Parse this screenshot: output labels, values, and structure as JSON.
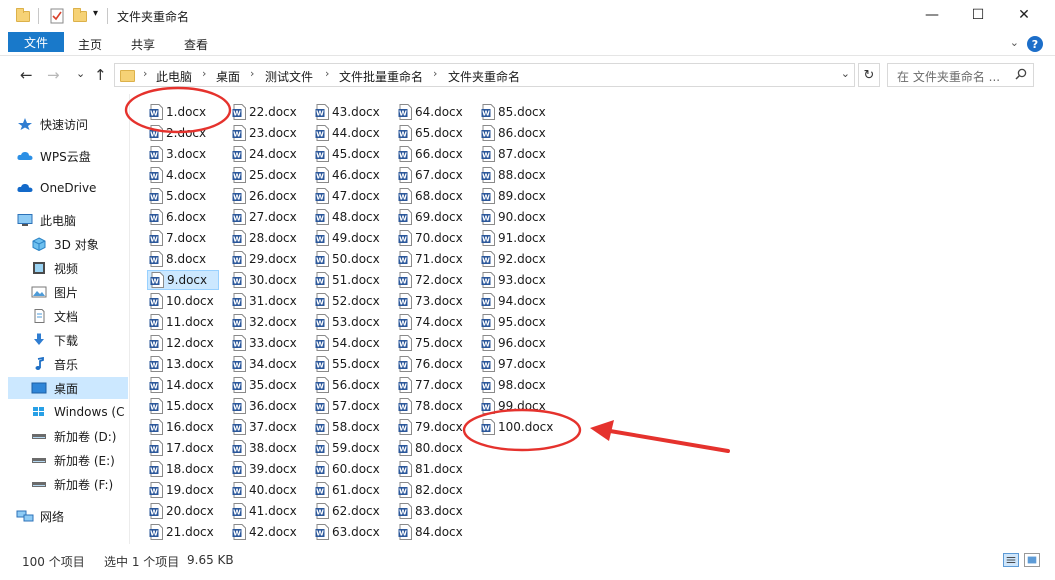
{
  "window": {
    "title": "文件夹重命名",
    "min_glyph": "—",
    "max_glyph": "☐",
    "close_glyph": "✕"
  },
  "ribbon": {
    "tabs": [
      "文件",
      "主页",
      "共享",
      "查看"
    ],
    "help_glyph": "?",
    "expand_glyph": "⌄"
  },
  "nav": {
    "back_glyph": "←",
    "forward_glyph": "→",
    "recent_glyph": "⌄",
    "up_glyph": "↑",
    "breadcrumb": [
      "此电脑",
      "桌面",
      "测试文件",
      "文件批量重命名",
      "文件夹重命名"
    ],
    "crumb_sep": "›",
    "refresh_glyph": "↻",
    "search_placeholder": "在 文件夹重命名 ..."
  },
  "sidebar": {
    "items": [
      {
        "label": "快速访问",
        "icon": "star-icon"
      },
      {
        "label": "WPS云盘",
        "icon": "cloud-icon"
      },
      {
        "label": "OneDrive",
        "icon": "onedrive-icon"
      },
      {
        "label": "此电脑",
        "icon": "computer-icon"
      },
      {
        "label": "3D 对象",
        "icon": "cube-icon"
      },
      {
        "label": "视频",
        "icon": "video-icon"
      },
      {
        "label": "图片",
        "icon": "picture-icon"
      },
      {
        "label": "文档",
        "icon": "document-icon"
      },
      {
        "label": "下载",
        "icon": "download-icon"
      },
      {
        "label": "音乐",
        "icon": "music-icon"
      },
      {
        "label": "桌面",
        "icon": "desktop-icon"
      },
      {
        "label": "Windows (C",
        "icon": "windows-drive-icon"
      },
      {
        "label": "新加卷 (D:)",
        "icon": "drive-icon"
      },
      {
        "label": "新加卷 (E:)",
        "icon": "drive-icon"
      },
      {
        "label": "新加卷 (F:)",
        "icon": "drive-icon"
      },
      {
        "label": "网络",
        "icon": "network-icon"
      }
    ],
    "selected": "桌面"
  },
  "files": {
    "extension": ".docx",
    "count": 100,
    "selected": "9.docx",
    "icon": "word-doc-icon"
  },
  "status": {
    "item_count": "100 个项目",
    "selection": "选中 1 个项目",
    "size": "9.65 KB"
  },
  "colors": {
    "accent": "#1979ca",
    "selection": "#cce8ff",
    "annotation": "#e5322d",
    "word_blue": "#2b579a"
  }
}
